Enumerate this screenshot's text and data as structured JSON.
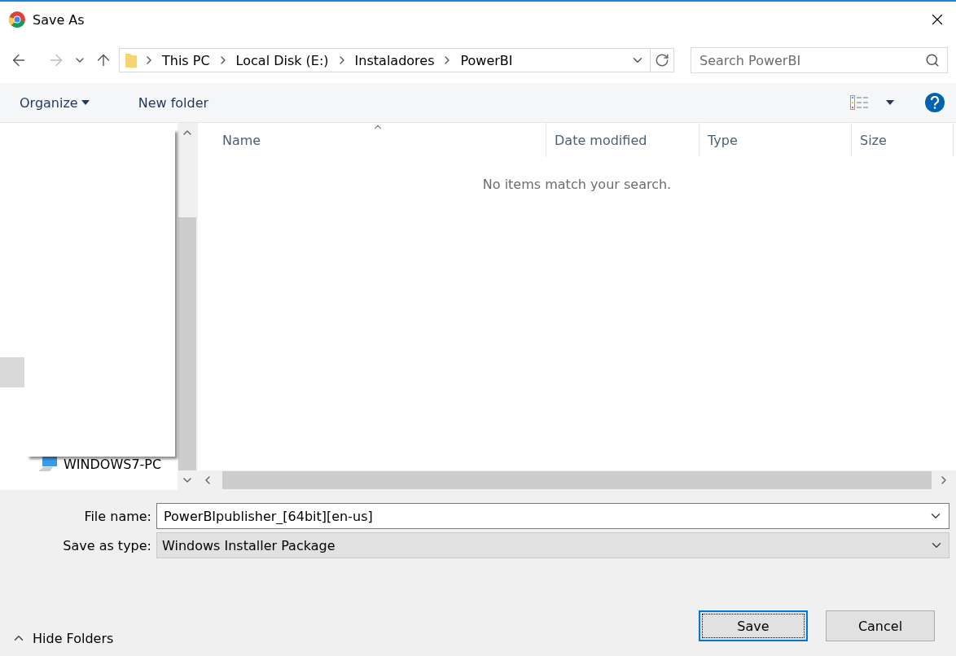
{
  "window": {
    "title": "Save As"
  },
  "breadcrumb": [
    "This PC",
    "Local Disk (E:)",
    "Instaladores",
    "PowerBI"
  ],
  "search": {
    "placeholder": "Search PowerBI"
  },
  "toolbar": {
    "organize": "Organize",
    "new_folder": "New folder"
  },
  "sidebar": {
    "items": [
      {
        "label": "WINDOWS7-PC"
      }
    ]
  },
  "table": {
    "columns": [
      {
        "label": "Name",
        "sorted": true
      },
      {
        "label": "Date modified",
        "sorted": false
      },
      {
        "label": "Type",
        "sorted": false
      },
      {
        "label": "Size",
        "sorted": false
      }
    ],
    "empty_message": "No items match your search."
  },
  "file_name": {
    "label": "File name:",
    "value": "PowerBIpublisher_[64bit][en-us]"
  },
  "save_type": {
    "label": "Save as type:",
    "value": "Windows Installer Package"
  },
  "hide_folders": "Hide Folders",
  "buttons": [
    {
      "label": "Save",
      "default": true
    },
    {
      "label": "Cancel",
      "default": false
    }
  ]
}
